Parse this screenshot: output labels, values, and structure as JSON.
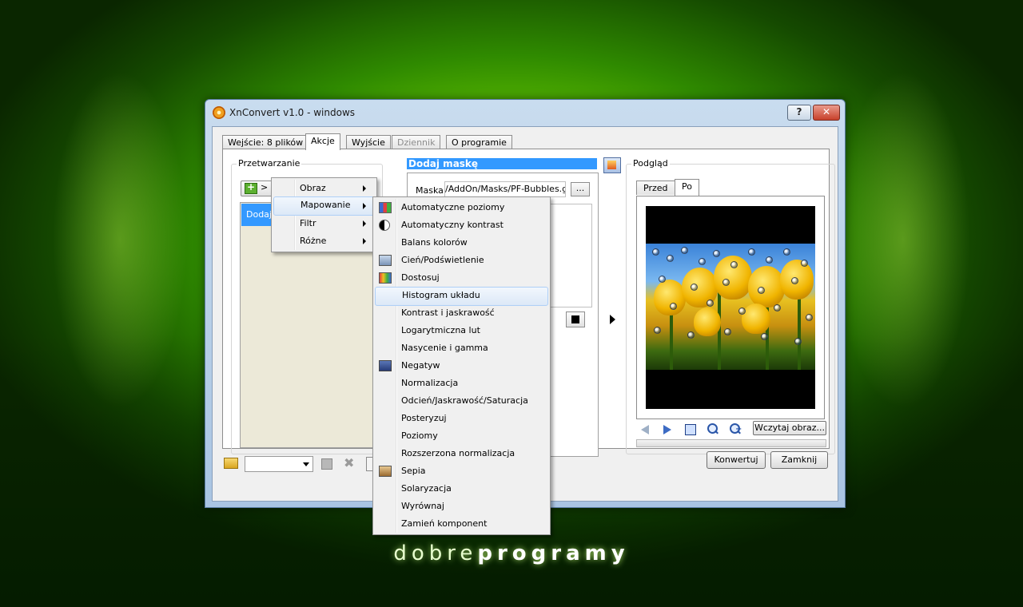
{
  "window": {
    "title": "XnConvert v1.0 - windows"
  },
  "titlebar": {
    "help_label": "?",
    "close_label": "✕"
  },
  "tabs": [
    "Wejście: 8 plików",
    "Akcje",
    "Wyjście",
    "Dziennik",
    "O programie"
  ],
  "active_tab": "Akcje",
  "processing": {
    "label": "Przetwarzanie",
    "add_button_label": ">",
    "list_items": [
      "Dodaj"
    ]
  },
  "action_panel": {
    "title": "Dodaj maskę",
    "mask_label": "Maska",
    "mask_value": "/AddOn/Masks/PF-Bubbles.gif",
    "browse_label": "..."
  },
  "preview": {
    "label": "Podgląd",
    "tabs": [
      "Przed",
      "Po"
    ],
    "active_tab": "Po",
    "load_button_label": "Wczytaj obraz..."
  },
  "bottom": {
    "convert_label": "Konwertuj",
    "close_label": "Zamknij"
  },
  "add_menu": {
    "items": [
      "Obraz",
      "Mapowanie",
      "Filtr",
      "Różne"
    ],
    "selected": "Mapowanie"
  },
  "mapping_submenu": {
    "items": [
      {
        "label": "Automatyczne poziomy",
        "icon": "levels-icon"
      },
      {
        "label": "Automatyczny kontrast",
        "icon": "contrast-icon"
      },
      {
        "label": "Balans kolorów",
        "icon": ""
      },
      {
        "label": "Cień/Podświetlenie",
        "icon": "shadow-highlight-icon"
      },
      {
        "label": "Dostosuj",
        "icon": "adjust-icon"
      },
      {
        "label": "Histogram układu",
        "icon": ""
      },
      {
        "label": "Kontrast i jaskrawość",
        "icon": ""
      },
      {
        "label": "Logarytmiczna lut",
        "icon": ""
      },
      {
        "label": "Nasycenie i gamma",
        "icon": ""
      },
      {
        "label": "Negatyw",
        "icon": "negative-icon"
      },
      {
        "label": "Normalizacja",
        "icon": ""
      },
      {
        "label": "Odcień/Jaskrawość/Saturacja",
        "icon": ""
      },
      {
        "label": "Posteryzuj",
        "icon": ""
      },
      {
        "label": "Poziomy",
        "icon": ""
      },
      {
        "label": "Rozszerzona normalizacja",
        "icon": ""
      },
      {
        "label": "Sepia",
        "icon": "sepia-icon"
      },
      {
        "label": "Solaryzacja",
        "icon": ""
      },
      {
        "label": "Wyrównaj",
        "icon": ""
      },
      {
        "label": "Zamień komponent",
        "icon": ""
      }
    ],
    "highlighted": "Histogram układu"
  },
  "watermark": {
    "part1": "dobre",
    "part2": "programy"
  },
  "colors": {
    "selection": "#3399ff",
    "background_green": "#6fd000"
  }
}
